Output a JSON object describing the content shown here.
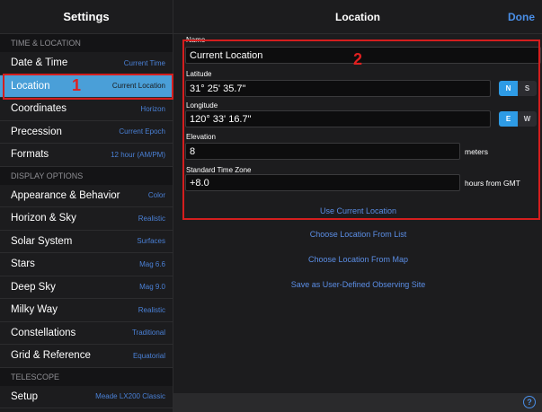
{
  "sidebar": {
    "title": "Settings",
    "sections": {
      "time_location": "TIME & LOCATION",
      "display_options": "DISPLAY OPTIONS",
      "telescope": "TELESCOPE"
    },
    "items": [
      {
        "label": "Date & Time",
        "value": "Current Time"
      },
      {
        "label": "Location",
        "value": "Current Location"
      },
      {
        "label": "Coordinates",
        "value": "Horizon"
      },
      {
        "label": "Precession",
        "value": "Current Epoch"
      },
      {
        "label": "Formats",
        "value": "12 hour (AM/PM)"
      },
      {
        "label": "Appearance & Behavior",
        "value": "Color"
      },
      {
        "label": "Horizon & Sky",
        "value": "Realistic"
      },
      {
        "label": "Solar System",
        "value": "Surfaces"
      },
      {
        "label": "Stars",
        "value": "Mag 6.6"
      },
      {
        "label": "Deep Sky",
        "value": "Mag 9.0"
      },
      {
        "label": "Milky Way",
        "value": "Realistic"
      },
      {
        "label": "Constellations",
        "value": "Traditional"
      },
      {
        "label": "Grid & Reference",
        "value": "Equatorial"
      },
      {
        "label": "Setup",
        "value": "Meade LX200 Classic"
      }
    ]
  },
  "main": {
    "title": "Location",
    "done_label": "Done",
    "name": {
      "label": "Name",
      "value": "Current Location"
    },
    "latitude": {
      "label": "Latitude",
      "value": "31° 25' 35.7\"",
      "options": [
        "N",
        "S"
      ],
      "selected": "N"
    },
    "longitude": {
      "label": "Longitude",
      "value": "120° 33' 16.7\"",
      "options": [
        "E",
        "W"
      ],
      "selected": "E"
    },
    "elevation": {
      "label": "Elevation",
      "value": "8",
      "unit": "meters"
    },
    "timezone": {
      "label": "Standard Time Zone",
      "value": "+8.0",
      "unit": "hours from GMT"
    },
    "actions": {
      "use_current": "Use Current Location",
      "from_list": "Choose Location From List",
      "from_map": "Choose Location From Map",
      "save_site": "Save as User-Defined Observing Site"
    },
    "help_label": "?"
  },
  "annotations": {
    "one": "1",
    "two": "2"
  },
  "colors": {
    "accent": "#4a8fe8",
    "selected_row": "#4a9fd8",
    "annotation": "#d41e1e"
  }
}
